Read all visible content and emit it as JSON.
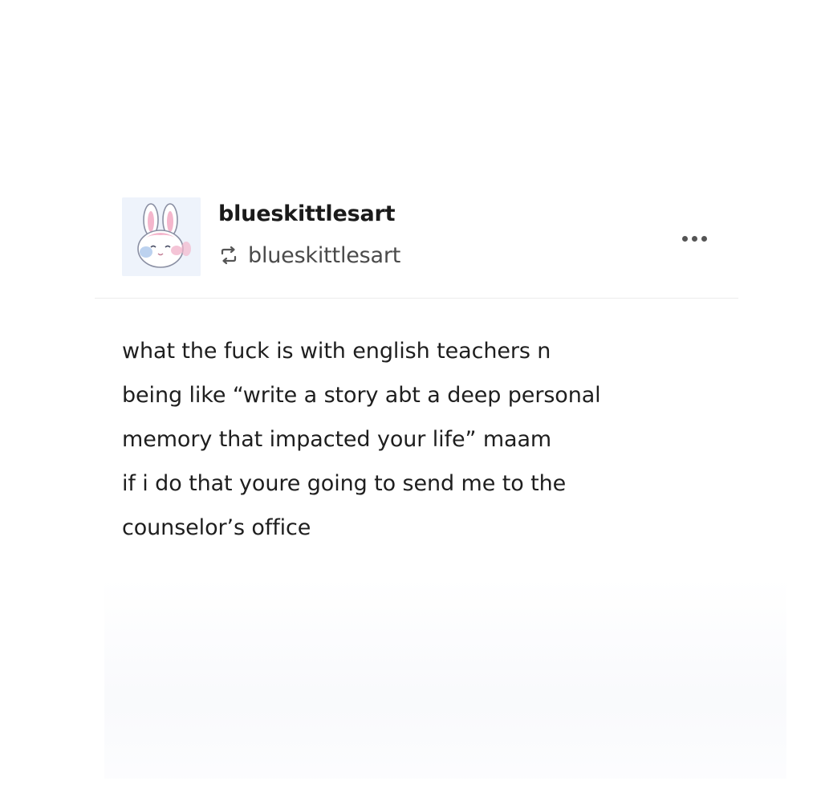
{
  "post": {
    "author": {
      "username": "blueskittlesart",
      "avatar_icon": "bunny-avatar-icon"
    },
    "reblog": {
      "icon": "reblog-icon",
      "from": "blueskittlesart"
    },
    "menu_icon": "more-options-icon",
    "body_lines": [
      "what the fuck is with english teachers n",
      "being like “write a story abt a deep personal",
      "memory that impacted your life” maam",
      "if i do that youre going to send me to the",
      "counselor’s office"
    ]
  },
  "colors": {
    "text": "#1e1e1e",
    "muted": "#4a4a4a",
    "avatar_bg": "#eef3fb",
    "accent_pink": "#f4b6cc"
  }
}
